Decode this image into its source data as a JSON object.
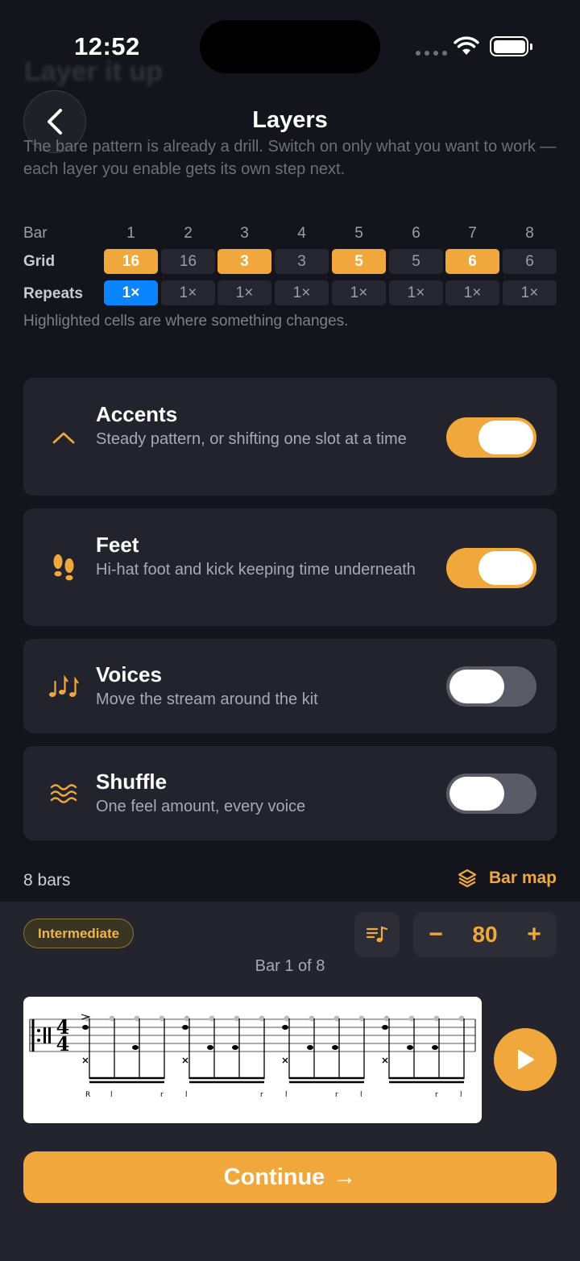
{
  "status": {
    "time": "12:52"
  },
  "header": {
    "ghost_title": "Layer it up",
    "title": "Layers",
    "intro": "The bare pattern is already a drill. Switch on only what you want to work — each layer you enable gets its own step next."
  },
  "grid": {
    "bar_label": "Bar",
    "grid_label": "Grid",
    "repeats_label": "Repeats",
    "bars": [
      "1",
      "2",
      "3",
      "4",
      "5",
      "6",
      "7",
      "8"
    ],
    "grid_values": [
      "16",
      "16",
      "3",
      "3",
      "5",
      "5",
      "6",
      "6"
    ],
    "grid_highlighted": [
      true,
      false,
      true,
      false,
      true,
      false,
      true,
      false
    ],
    "repeats": [
      "1×",
      "1×",
      "1×",
      "1×",
      "1×",
      "1×",
      "1×",
      "1×"
    ],
    "repeats_highlighted": [
      true,
      false,
      false,
      false,
      false,
      false,
      false,
      false
    ],
    "note": "Highlighted cells are where something changes."
  },
  "layers": [
    {
      "title": "Accents",
      "desc": "Steady pattern, or shifting one slot at a time",
      "icon": "chevron-up-icon",
      "enabled": true
    },
    {
      "title": "Feet",
      "desc": "Hi-hat foot and kick keeping time underneath",
      "icon": "footprints-icon",
      "enabled": true
    },
    {
      "title": "Voices",
      "desc": "Move the stream around the kit",
      "icon": "music-notes-icon",
      "enabled": false
    },
    {
      "title": "Shuffle",
      "desc": "One feel amount, every voice",
      "icon": "waves-icon",
      "enabled": false
    }
  ],
  "summary": {
    "bars_count": "8 bars",
    "bar_map_label": "Bar map"
  },
  "player": {
    "level": "Intermediate",
    "tempo": "80",
    "tempo_minus": "−",
    "tempo_plus": "+",
    "bar_indicator": "Bar 1 of 8",
    "time_signature_top": "4",
    "time_signature_bottom": "4",
    "sticking": [
      "R",
      "l",
      "r",
      "l",
      "r",
      "l",
      "r",
      "l",
      "r",
      "l"
    ]
  },
  "footer": {
    "continue_label": "Continue",
    "continue_arrow": "→"
  },
  "colors": {
    "accent": "#f0a83c",
    "highlight_blue": "#0a84ff",
    "background": "#14151c",
    "card": "#22232d"
  }
}
